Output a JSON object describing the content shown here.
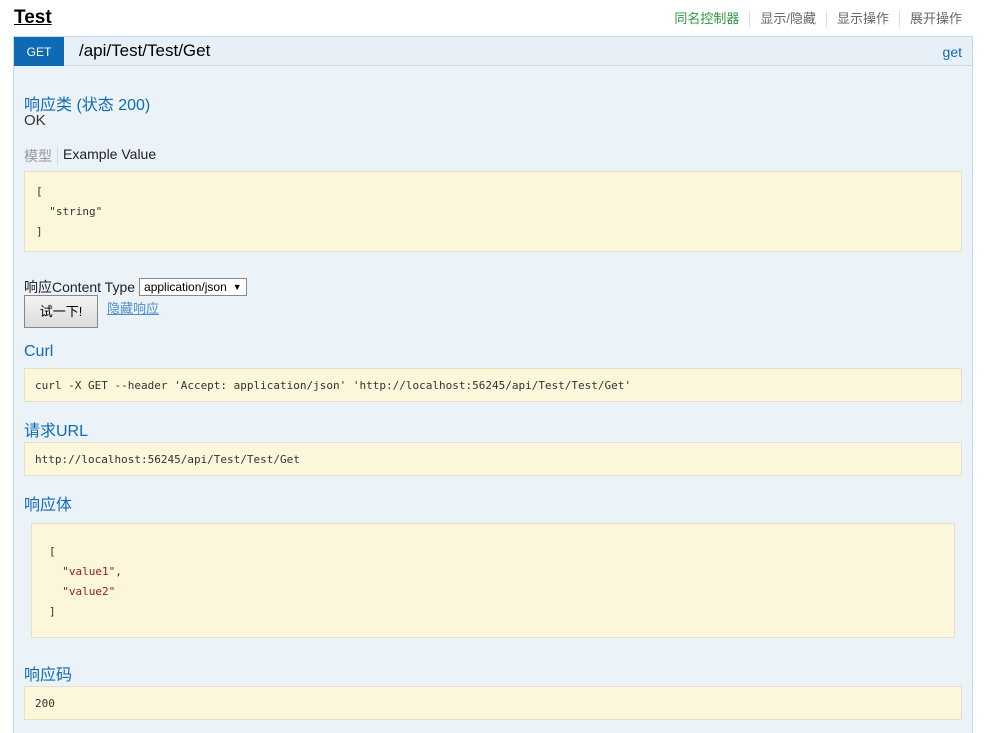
{
  "resource": {
    "title": "Test",
    "links": [
      "同名控制器",
      "显示/隐藏",
      "显示操作",
      "展开操作"
    ]
  },
  "operation": {
    "method": "GET",
    "path": "/api/Test/Test/Get",
    "summary": "get",
    "response_class_heading": "响应类 (状态 200)",
    "response_class_value": "OK",
    "tab_model": "模型",
    "tab_example": "Example Value",
    "example_lines": [
      "[",
      "  \"string\"",
      "]"
    ],
    "content_type_label": "响应Content Type",
    "content_type_value": "application/json",
    "try_button": "试一下!",
    "hide_response_link": "隐藏响应",
    "curl_heading": "Curl",
    "curl_command": "curl -X GET --header 'Accept: application/json' 'http://localhost:56245/api/Test/Test/Get'",
    "request_url_heading": "请求URL",
    "request_url": "http://localhost:56245/api/Test/Test/Get",
    "response_body_heading": "响应体",
    "response_body": {
      "open": "[",
      "item1": "\"value1\"",
      "item2": "\"value2\"",
      "close": "]"
    },
    "response_code_heading": "响应码",
    "response_code": "200"
  },
  "colors": {
    "method_get": "#0f6ab4",
    "panel_bg": "#ebf3f9",
    "code_bg": "#fcf6db",
    "heading_blue": "#0f6ab4",
    "active_link_green": "#2f9a40"
  }
}
